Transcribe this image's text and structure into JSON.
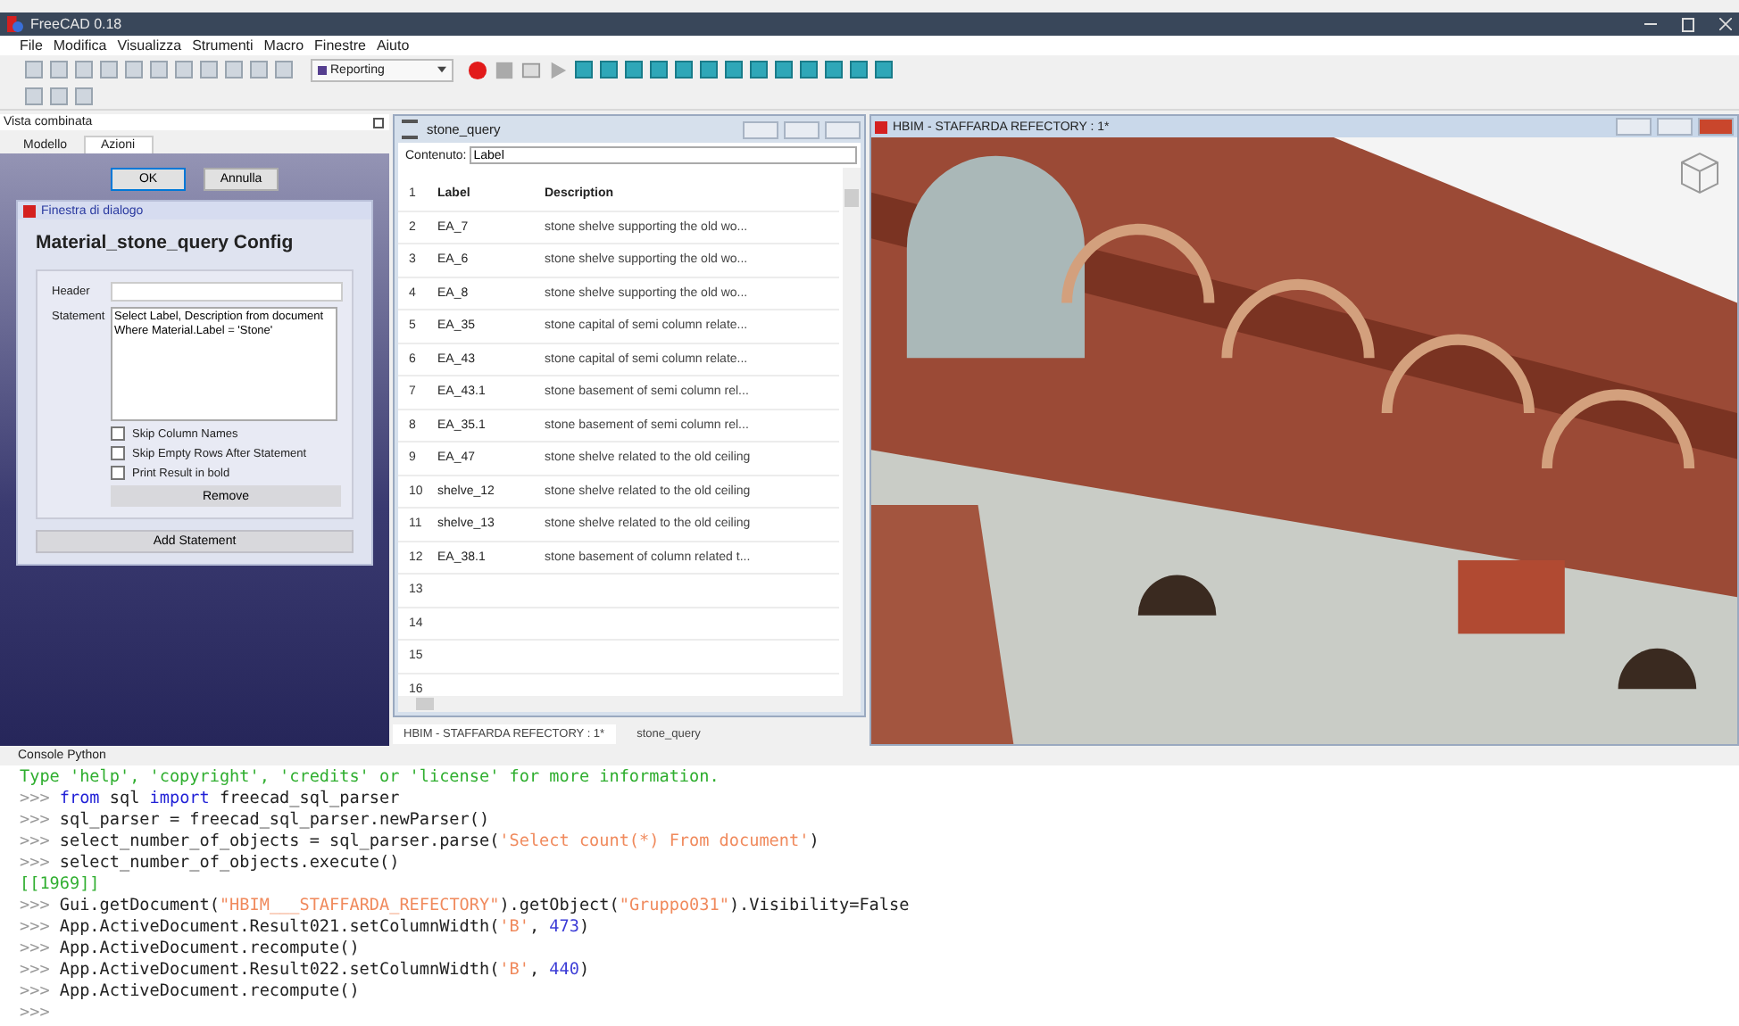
{
  "window": {
    "title": "FreeCAD 0.18"
  },
  "menu": [
    "File",
    "Modifica",
    "Visualizza",
    "Strumenti",
    "Macro",
    "Finestre",
    "Aiuto"
  ],
  "workbench": {
    "value": "Reporting"
  },
  "combo_view": {
    "title": "Vista combinata",
    "tabs": [
      {
        "label": "Modello",
        "selected": false
      },
      {
        "label": "Azioni",
        "selected": true
      }
    ],
    "buttons": [
      "OK",
      "Annulla"
    ],
    "dialog": {
      "title": "Finestra di dialogo",
      "heading": "Material_stone_query Config",
      "header_label": "Header",
      "statement_label": "Statement",
      "statement": "Select Label, Description from document\nWhere Material.Label = 'Stone'",
      "options": [
        {
          "label": "Skip Column Names",
          "checked": false
        },
        {
          "label": "Skip Empty Rows After Statement",
          "checked": false
        },
        {
          "label": "Print Result in bold",
          "checked": false
        }
      ],
      "remove_button": "Remove",
      "add_button": "Add Statement"
    }
  },
  "spreadsheet": {
    "title": "stone_query",
    "content_label": "Contenuto:",
    "content_value": "Label",
    "header_row": {
      "number": "1",
      "cells": [
        "Label",
        "Description"
      ]
    },
    "rows": [
      {
        "number": "2",
        "label": "EA_7",
        "description": "stone shelve supporting the old wo..."
      },
      {
        "number": "3",
        "label": "EA_6",
        "description": "stone shelve supporting the old wo..."
      },
      {
        "number": "4",
        "label": "EA_8",
        "description": "stone shelve supporting the old wo..."
      },
      {
        "number": "5",
        "label": "EA_35",
        "description": "stone capital of semi column relate..."
      },
      {
        "number": "6",
        "label": "EA_43",
        "description": "stone capital of semi column relate..."
      },
      {
        "number": "7",
        "label": "EA_43.1",
        "description": "stone basement of semi column rel..."
      },
      {
        "number": "8",
        "label": "EA_35.1",
        "description": "stone basement of semi column rel..."
      },
      {
        "number": "9",
        "label": "EA_47",
        "description": "stone shelve related to the old ceiling"
      },
      {
        "number": "10",
        "label": "shelve_12",
        "description": "stone shelve related to the old ceiling"
      },
      {
        "number": "11",
        "label": "shelve_13",
        "description": "stone shelve related to the old ceiling"
      },
      {
        "number": "12",
        "label": "EA_38.1",
        "description": "stone basement of column related t..."
      },
      {
        "number": "13"
      },
      {
        "number": "14"
      },
      {
        "number": "15"
      },
      {
        "number": "16"
      }
    ]
  },
  "view3d": {
    "title": "HBIM - STAFFARDA REFECTORY : 1*"
  },
  "document_tabs": [
    {
      "label": "HBIM - STAFFARDA REFECTORY : 1*",
      "selected": true
    },
    {
      "label": "stone_query",
      "selected": false
    }
  ],
  "console": {
    "title": "Console Python",
    "lines": [
      [
        {
          "kind": "info",
          "text": "Type 'help', 'copyright', 'credits' or 'license' for more information."
        }
      ],
      [
        {
          "kind": "prompt",
          "text": ">>> "
        },
        {
          "kind": "keyword",
          "text": "from"
        },
        {
          "kind": "plain",
          "text": " sql "
        },
        {
          "kind": "keyword",
          "text": "import"
        },
        {
          "kind": "plain",
          "text": " freecad_sql_parser"
        }
      ],
      [
        {
          "kind": "prompt",
          "text": ">>> "
        },
        {
          "kind": "plain",
          "text": "sql_parser = freecad_sql_parser.newParser()"
        }
      ],
      [
        {
          "kind": "prompt",
          "text": ">>> "
        },
        {
          "kind": "plain",
          "text": "select_number_of_objects = sql_parser.parse("
        },
        {
          "kind": "string",
          "text": "'Select count(*) From document'"
        },
        {
          "kind": "plain",
          "text": ")"
        }
      ],
      [
        {
          "kind": "prompt",
          "text": ">>> "
        },
        {
          "kind": "plain",
          "text": "select_number_of_objects.execute()"
        }
      ],
      [
        {
          "kind": "info",
          "text": "[[1969]]"
        }
      ],
      [
        {
          "kind": "prompt",
          "text": ">>> "
        },
        {
          "kind": "plain",
          "text": "Gui.getDocument("
        },
        {
          "kind": "string",
          "text": "\"HBIM___STAFFARDA_REFECTORY\""
        },
        {
          "kind": "plain",
          "text": ").getObject("
        },
        {
          "kind": "string",
          "text": "\"Gruppo031\""
        },
        {
          "kind": "plain",
          "text": ").Visibility=False"
        }
      ],
      [
        {
          "kind": "prompt",
          "text": ">>> "
        },
        {
          "kind": "plain",
          "text": "App.ActiveDocument.Result021.setColumnWidth("
        },
        {
          "kind": "string",
          "text": "'B'"
        },
        {
          "kind": "plain",
          "text": ", "
        },
        {
          "kind": "number",
          "text": "473"
        },
        {
          "kind": "plain",
          "text": ")"
        }
      ],
      [
        {
          "kind": "prompt",
          "text": ">>> "
        },
        {
          "kind": "plain",
          "text": "App.ActiveDocument.recompute()"
        }
      ],
      [
        {
          "kind": "prompt",
          "text": ">>> "
        },
        {
          "kind": "plain",
          "text": "App.ActiveDocument.Result022.setColumnWidth("
        },
        {
          "kind": "string",
          "text": "'B'"
        },
        {
          "kind": "plain",
          "text": ", "
        },
        {
          "kind": "number",
          "text": "440"
        },
        {
          "kind": "plain",
          "text": ")"
        }
      ],
      [
        {
          "kind": "prompt",
          "text": ">>> "
        },
        {
          "kind": "plain",
          "text": "App.ActiveDocument.recompute()"
        }
      ],
      [
        {
          "kind": "prompt",
          "text": ">>>"
        }
      ]
    ]
  }
}
